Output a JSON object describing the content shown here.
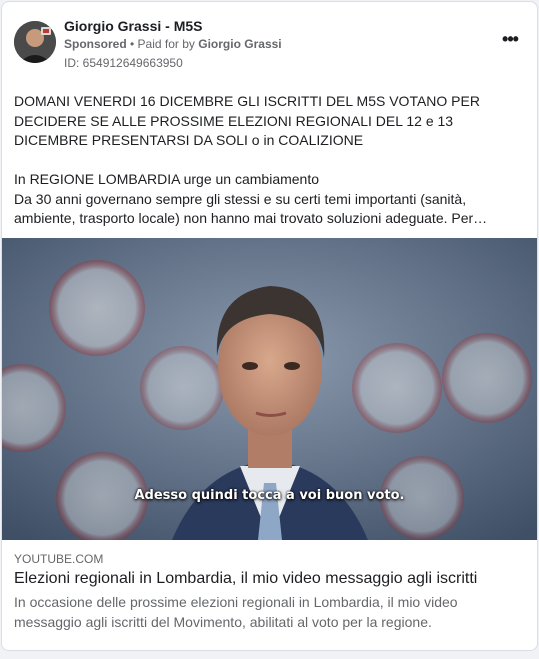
{
  "post": {
    "author": "Giorgio Grassi - M5S",
    "sponsored_label": "Sponsored",
    "separator": " • ",
    "paid_for_prefix": "Paid for by",
    "paid_for_name": "Giorgio Grassi",
    "id_label": "ID: 654912649663950",
    "more_icon": "more-horizontal-icon",
    "more_label": "•••"
  },
  "body": {
    "headline": "DOMANI VENERDI 16 DICEMBRE GLI ISCRITTI DEL M5S VOTANO PER DECIDERE SE ALLE PROSSIME ELEZIONI REGIONALI DEL 12 e 13 DICEMBRE PRESENTARSI DA SOLI o in COALIZIONE",
    "line1": "In REGIONE LOMBARDIA urge un cambiamento",
    "line2": "Da 30 anni governano sempre gli stessi e su certi temi importanti (sanità, ambiente, trasporto locale) non hanno mai trovato soluzioni adeguate. Per…"
  },
  "media": {
    "caption": "Adesso quindi tocca a voi buon voto."
  },
  "link": {
    "domain": "YOUTUBE.COM",
    "title": "Elezioni regionali in Lombardia, il mio video messaggio agli iscritti",
    "description": "In occasione delle prossime elezioni regionali in Lombardia, il mio video messaggio agli iscritti del Movimento, abilitati al voto per la regione."
  },
  "colors": {
    "text_primary": "#1c1e21",
    "text_secondary": "#65676b",
    "card_border": "#dadde1",
    "video_bg": "#5a6b80",
    "suit": "#2a3a5c"
  }
}
